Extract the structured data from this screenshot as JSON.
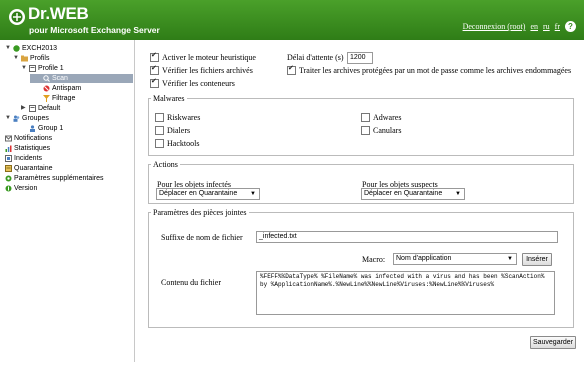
{
  "header": {
    "title": "Dr.WEB",
    "subtitle": "pour Microsoft Exchange Server",
    "logout": "Deconnexion (root)",
    "lang_en": "en",
    "lang_ru": "ru",
    "lang_fr": "fr",
    "help": "?",
    "colors": {
      "green_top": "#4aa02a",
      "green_bottom": "#2f7d17"
    }
  },
  "tree": {
    "root": "EXCH2013",
    "profils": "Profils",
    "profile1": "Profile 1",
    "scan": "Scan",
    "antispam": "Antispam",
    "filtrage": "Filtrage",
    "default": "Default",
    "groupes": "Groupes",
    "group1": "Group 1",
    "notifications": "Notifications",
    "statistiques": "Statistiques",
    "incidents": "Incidents",
    "quarantaine": "Quarantaine",
    "params_supp": "Paramètres supplémentaires",
    "version": "Version"
  },
  "options": {
    "heuristic": "Activer le moteur heuristique",
    "archives": "Vérifier les fichiers archivés",
    "containers": "Vérifier les conteneurs",
    "delay_label": "Délai d'attente (s)",
    "delay_value": "1200",
    "protected": "Traiter les archives protégées par un mot de passe comme les archives endommagées"
  },
  "malwares": {
    "legend": "Malwares",
    "riskwares": "Riskwares",
    "dialers": "Dialers",
    "hacktools": "Hacktools",
    "adwares": "Adwares",
    "canulars": "Canulars"
  },
  "actions": {
    "legend": "Actions",
    "infected_label": "Pour les objets infectés",
    "infected_value": "Déplacer en Quarantaine",
    "suspect_label": "Pour les objets suspects",
    "suspect_value": "Déplacer en Quarantaine"
  },
  "attachments": {
    "legend": "Paramètres des pièces jointes",
    "suffix_label": "Suffixe de nom de fichier",
    "suffix_value": "_infected.txt",
    "macro_label": "Macro:",
    "macro_value": "Nom d'application",
    "insert_button": "Insérer",
    "content_label": "Contenu du fichier",
    "content_value": "%FEFF%%DataType% %FileName% was infected with a virus and has been %ScanAction% by %ApplicationName%.%NewLine%%NewLine%Viruses:%NewLine%%Viruses%"
  },
  "save_button": "Sauvegarder"
}
